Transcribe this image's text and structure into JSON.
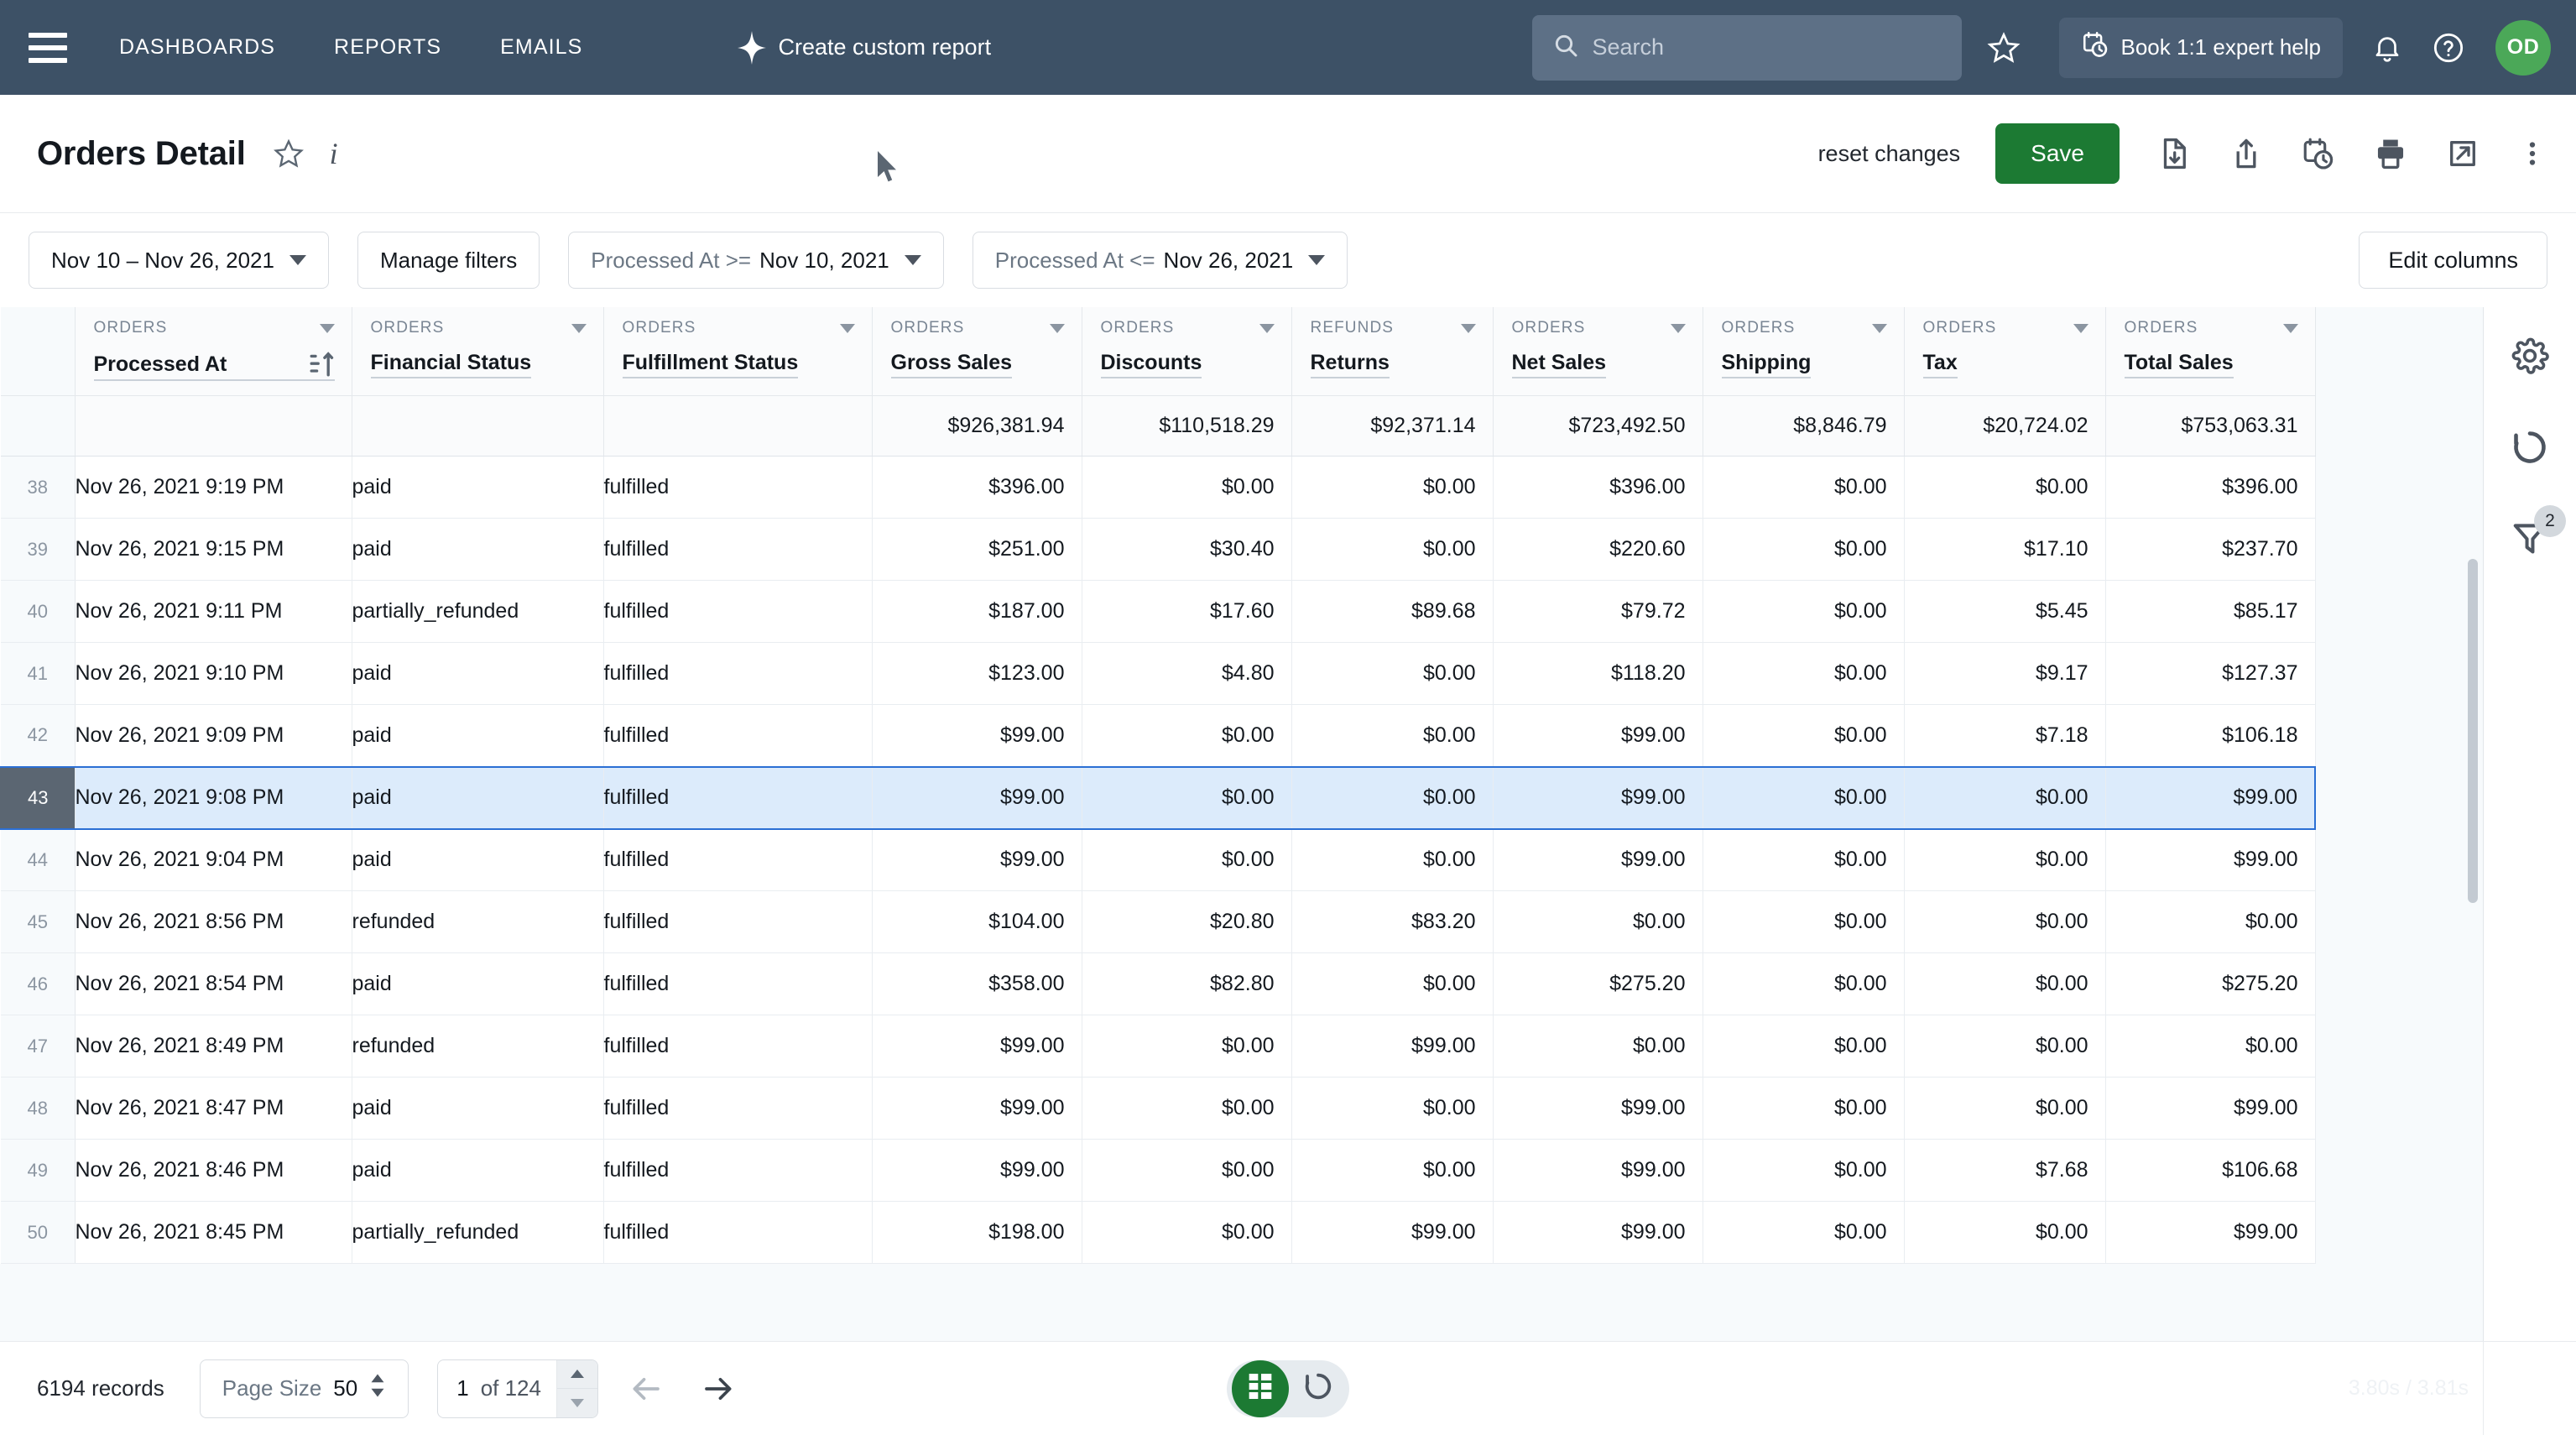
{
  "topnav": {
    "menu_icon": "hamburger-icon",
    "links": [
      "DASHBOARDS",
      "REPORTS",
      "EMAILS"
    ],
    "create_report_label": "Create custom report",
    "create_report_icon": "sparkle-icon",
    "search": {
      "placeholder": "Search",
      "value": "",
      "icon": "search-icon"
    },
    "star_icon": "star-outline-icon",
    "book_help_label": "Book 1:1 expert help",
    "book_help_icon": "calendar-clock-icon",
    "bell_icon": "bell-icon",
    "help_icon": "question-circle-icon",
    "avatar_initials": "OD",
    "avatar_color": "#4ba858",
    "bg_color": "#3d5166"
  },
  "titlebar": {
    "title": "Orders Detail",
    "star_icon": "star-outline-icon",
    "info_icon": "info-italic-icon",
    "reset_label": "reset changes",
    "save_label": "Save",
    "save_color": "#1c7a33",
    "actions": [
      {
        "icon": "file-download-icon",
        "name": "download-button"
      },
      {
        "icon": "share-upload-icon",
        "name": "share-button"
      },
      {
        "icon": "calendar-clock-icon",
        "name": "schedule-button"
      },
      {
        "icon": "printer-icon",
        "name": "print-button"
      },
      {
        "icon": "external-link-icon",
        "name": "open-external-button"
      },
      {
        "icon": "more-vertical-icon",
        "name": "more-button"
      }
    ]
  },
  "filterbar": {
    "date_range": "Nov 10 – Nov 26, 2021",
    "manage_filters": "Manage filters",
    "filter_1_field": "Processed At >=",
    "filter_1_value": "Nov 10, 2021",
    "filter_2_field": "Processed At <=",
    "filter_2_value": "Nov 26, 2021",
    "edit_columns": "Edit columns"
  },
  "rail": {
    "settings_icon": "gear-icon",
    "refresh_icon": "refresh-circle-icon",
    "filter_icon": "funnel-icon",
    "filter_badge": "2"
  },
  "table": {
    "columns": [
      {
        "group": "ORDERS",
        "name": "Processed At",
        "align": "left",
        "sorted": true
      },
      {
        "group": "ORDERS",
        "name": "Financial Status",
        "align": "left",
        "sorted": false
      },
      {
        "group": "ORDERS",
        "name": "Fulfillment Status",
        "align": "left",
        "sorted": false
      },
      {
        "group": "ORDERS",
        "name": "Gross Sales",
        "align": "right",
        "sorted": false
      },
      {
        "group": "ORDERS",
        "name": "Discounts",
        "align": "right",
        "sorted": false
      },
      {
        "group": "REFUNDS",
        "name": "Returns",
        "align": "right",
        "sorted": false
      },
      {
        "group": "ORDERS",
        "name": "Net Sales",
        "align": "right",
        "sorted": false
      },
      {
        "group": "ORDERS",
        "name": "Shipping",
        "align": "right",
        "sorted": false
      },
      {
        "group": "ORDERS",
        "name": "Tax",
        "align": "right",
        "sorted": false
      },
      {
        "group": "ORDERS",
        "name": "Total Sales",
        "align": "right",
        "sorted": false
      }
    ],
    "totals": [
      "",
      "",
      "",
      "$926,381.94",
      "$110,518.29",
      "$92,371.14",
      "$723,492.50",
      "$8,846.79",
      "$20,724.02",
      "$753,063.31"
    ],
    "selected_row_index": 5,
    "rows": [
      {
        "n": "38",
        "cells": [
          "Nov 26, 2021 9:19 PM",
          "paid",
          "fulfilled",
          "$396.00",
          "$0.00",
          "$0.00",
          "$396.00",
          "$0.00",
          "$0.00",
          "$396.00"
        ]
      },
      {
        "n": "39",
        "cells": [
          "Nov 26, 2021 9:15 PM",
          "paid",
          "fulfilled",
          "$251.00",
          "$30.40",
          "$0.00",
          "$220.60",
          "$0.00",
          "$17.10",
          "$237.70"
        ]
      },
      {
        "n": "40",
        "cells": [
          "Nov 26, 2021 9:11 PM",
          "partially_refunded",
          "fulfilled",
          "$187.00",
          "$17.60",
          "$89.68",
          "$79.72",
          "$0.00",
          "$5.45",
          "$85.17"
        ]
      },
      {
        "n": "41",
        "cells": [
          "Nov 26, 2021 9:10 PM",
          "paid",
          "fulfilled",
          "$123.00",
          "$4.80",
          "$0.00",
          "$118.20",
          "$0.00",
          "$9.17",
          "$127.37"
        ]
      },
      {
        "n": "42",
        "cells": [
          "Nov 26, 2021 9:09 PM",
          "paid",
          "fulfilled",
          "$99.00",
          "$0.00",
          "$0.00",
          "$99.00",
          "$0.00",
          "$7.18",
          "$106.18"
        ]
      },
      {
        "n": "43",
        "cells": [
          "Nov 26, 2021 9:08 PM",
          "paid",
          "fulfilled",
          "$99.00",
          "$0.00",
          "$0.00",
          "$99.00",
          "$0.00",
          "$0.00",
          "$99.00"
        ]
      },
      {
        "n": "44",
        "cells": [
          "Nov 26, 2021 9:04 PM",
          "paid",
          "fulfilled",
          "$99.00",
          "$0.00",
          "$0.00",
          "$99.00",
          "$0.00",
          "$0.00",
          "$99.00"
        ]
      },
      {
        "n": "45",
        "cells": [
          "Nov 26, 2021 8:56 PM",
          "refunded",
          "fulfilled",
          "$104.00",
          "$20.80",
          "$83.20",
          "$0.00",
          "$0.00",
          "$0.00",
          "$0.00"
        ]
      },
      {
        "n": "46",
        "cells": [
          "Nov 26, 2021 8:54 PM",
          "paid",
          "fulfilled",
          "$358.00",
          "$82.80",
          "$0.00",
          "$275.20",
          "$0.00",
          "$0.00",
          "$275.20"
        ]
      },
      {
        "n": "47",
        "cells": [
          "Nov 26, 2021 8:49 PM",
          "refunded",
          "fulfilled",
          "$99.00",
          "$0.00",
          "$99.00",
          "$0.00",
          "$0.00",
          "$0.00",
          "$0.00"
        ]
      },
      {
        "n": "48",
        "cells": [
          "Nov 26, 2021 8:47 PM",
          "paid",
          "fulfilled",
          "$99.00",
          "$0.00",
          "$0.00",
          "$99.00",
          "$0.00",
          "$0.00",
          "$99.00"
        ]
      },
      {
        "n": "49",
        "cells": [
          "Nov 26, 2021 8:46 PM",
          "paid",
          "fulfilled",
          "$99.00",
          "$0.00",
          "$0.00",
          "$99.00",
          "$0.00",
          "$7.68",
          "$106.68"
        ]
      },
      {
        "n": "50",
        "cells": [
          "Nov 26, 2021 8:45 PM",
          "partially_refunded",
          "fulfilled",
          "$198.00",
          "$0.00",
          "$99.00",
          "$99.00",
          "$0.00",
          "$0.00",
          "$99.00"
        ]
      }
    ]
  },
  "footer": {
    "records": "6194 records",
    "page_size_label": "Page Size",
    "page_size_value": "50",
    "page_number": "1",
    "page_of": "of 124",
    "prev_icon": "arrow-left-icon",
    "next_icon": "arrow-right-icon",
    "grid_view_icon": "table-grid-icon",
    "refresh_icon": "refresh-circle-icon",
    "timing": "3.80s / 3.81s"
  }
}
